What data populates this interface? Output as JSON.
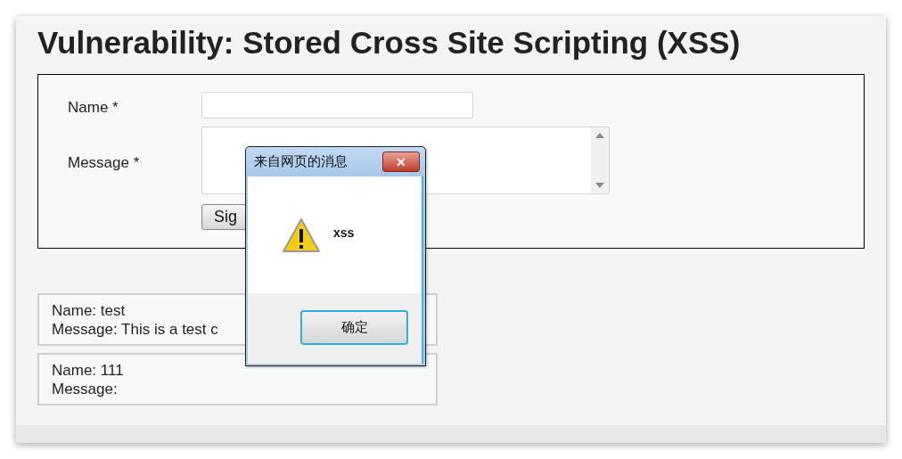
{
  "page": {
    "title": "Vulnerability: Stored Cross Site Scripting (XSS)"
  },
  "form": {
    "name_label": "Name *",
    "message_label": "Message *",
    "submit": "Sig"
  },
  "entries": [
    {
      "name": "Name: test",
      "message": "Message: This is a test c"
    },
    {
      "name": "Name: 111",
      "message": "Message:"
    }
  ],
  "dialog": {
    "title": "来自网页的消息",
    "close": "✕",
    "message": "xss",
    "ok": "确定"
  }
}
